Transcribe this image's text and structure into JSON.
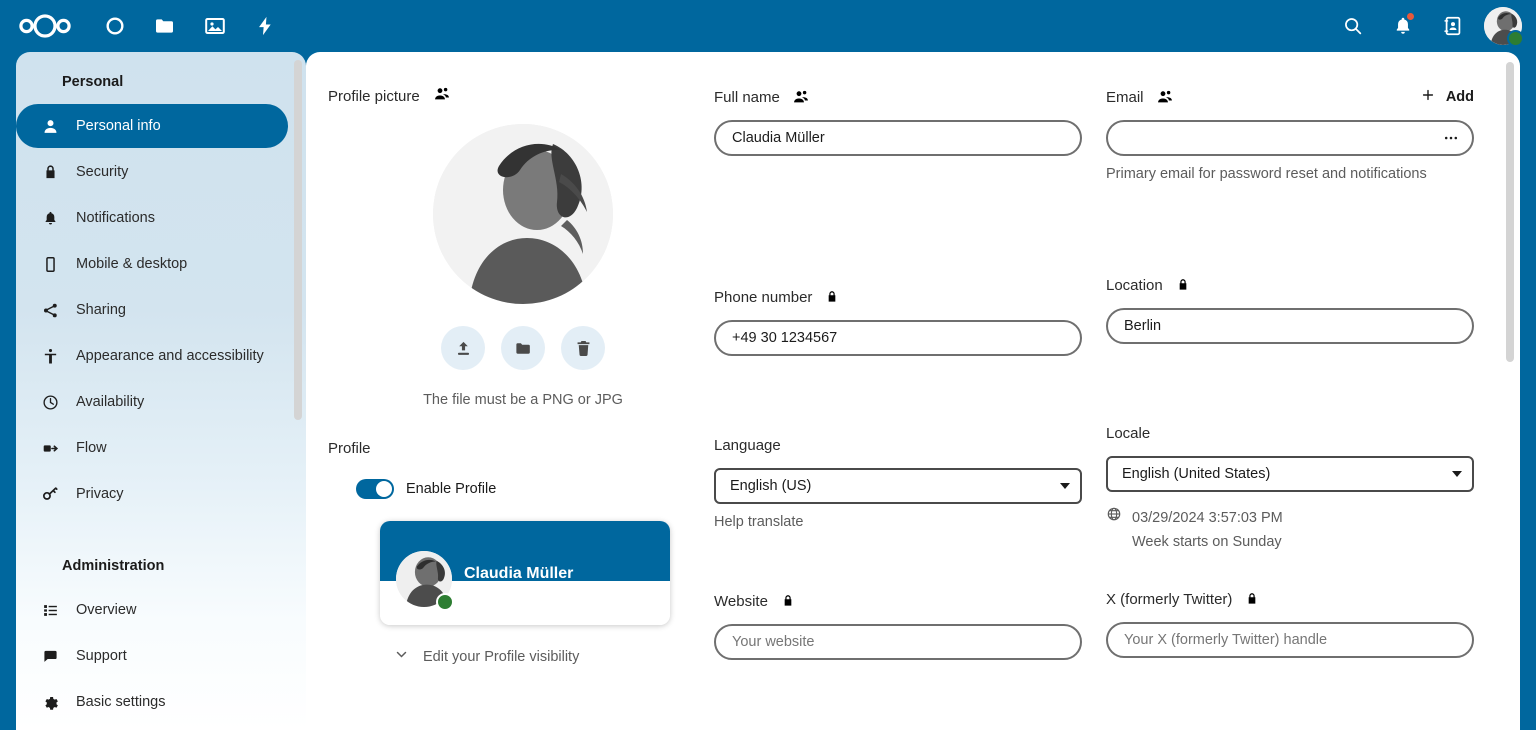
{
  "header": {
    "logo_name": "nextcloud-logo",
    "apps": [
      {
        "name": "dashboard",
        "icon": "circle-icon"
      },
      {
        "name": "files",
        "icon": "folder-icon"
      },
      {
        "name": "photos",
        "icon": "image-icon"
      },
      {
        "name": "activity",
        "icon": "lightning-icon"
      }
    ],
    "actions": [
      {
        "name": "search",
        "icon": "search-icon"
      },
      {
        "name": "notifications",
        "icon": "bell-icon",
        "badge": true
      },
      {
        "name": "contacts",
        "icon": "contacts-icon"
      }
    ],
    "avatar": {
      "name": "user-avatar",
      "status": "online"
    }
  },
  "sidebar": {
    "personal_caption": "Personal",
    "admin_caption": "Administration",
    "personal_items": [
      {
        "label": "Personal info",
        "icon": "account-icon",
        "active": true
      },
      {
        "label": "Security",
        "icon": "lock-icon",
        "active": false
      },
      {
        "label": "Notifications",
        "icon": "bell-icon",
        "active": false
      },
      {
        "label": "Mobile & desktop",
        "icon": "cellphone-icon",
        "active": false
      },
      {
        "label": "Sharing",
        "icon": "share-icon",
        "active": false
      },
      {
        "label": "Appearance and accessibility",
        "icon": "accessibility-icon",
        "active": false
      },
      {
        "label": "Availability",
        "icon": "clock-icon",
        "active": false
      },
      {
        "label": "Flow",
        "icon": "flow-icon",
        "active": false
      },
      {
        "label": "Privacy",
        "icon": "key-icon",
        "active": false
      }
    ],
    "admin_items": [
      {
        "label": "Overview",
        "icon": "list-icon"
      },
      {
        "label": "Support",
        "icon": "comment-icon"
      },
      {
        "label": "Basic settings",
        "icon": "cog-icon"
      }
    ]
  },
  "profile_picture": {
    "title": "Profile picture",
    "scope_icon": "contacts-scope-icon",
    "hint": "The file must be a PNG or JPG",
    "actions": [
      {
        "name": "upload-picture",
        "icon": "upload-icon"
      },
      {
        "name": "choose-from-files",
        "icon": "folder-icon"
      },
      {
        "name": "remove-picture",
        "icon": "delete-icon"
      }
    ]
  },
  "profile": {
    "title": "Profile",
    "toggle_label": "Enable Profile",
    "toggle_on": true,
    "card_name": "Claudia Müller",
    "card_status": "online",
    "visibility_label": "Edit your Profile visibility",
    "visibility_icon": "chevron-down-icon"
  },
  "form": {
    "full_name": {
      "label": "Full name",
      "scope_icon": "contacts-scope-icon",
      "value": "Claudia Müller"
    },
    "email": {
      "label": "Email",
      "scope_icon": "contacts-scope-icon",
      "add_label": "Add",
      "add_icon": "plus-icon",
      "value": "",
      "placeholder": "",
      "menu_icon": "dots-horizontal-icon",
      "helper": "Primary email for password reset and notifications"
    },
    "phone": {
      "label": "Phone number",
      "scope_icon": "lock-scope-icon",
      "value": "+49 30 1234567"
    },
    "location": {
      "label": "Location",
      "scope_icon": "lock-scope-icon",
      "value": "Berlin"
    },
    "language": {
      "label": "Language",
      "value": "English (US)",
      "helper": "Help translate"
    },
    "locale": {
      "label": "Locale",
      "value": "English (United States)",
      "info_icon": "globe-icon",
      "datetime": "03/29/2024 3:57:03 PM",
      "week_start": "Week starts on Sunday"
    },
    "website": {
      "label": "Website",
      "scope_icon": "lock-scope-icon",
      "value": "",
      "placeholder": "Your website"
    },
    "twitter": {
      "label": "X (formerly Twitter)",
      "scope_icon": "lock-scope-icon",
      "value": "",
      "placeholder": "Your X (formerly Twitter) handle"
    }
  },
  "colors": {
    "brand": "#00679e",
    "sidebar_top": "#cfe2ee",
    "status_online": "#2d7d32",
    "badge": "#e8593b"
  }
}
